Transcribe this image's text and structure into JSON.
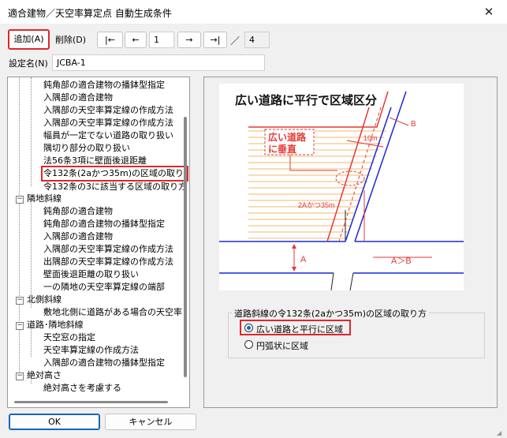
{
  "window": {
    "title": "適合建物／天空率算定点 自動生成条件",
    "close_glyph": "✕"
  },
  "toolbar": {
    "add_label": "追加(A)",
    "delete_label": "削除(D)",
    "first_label": "|←",
    "prev_label": "←",
    "current_page": "1",
    "next_label": "→",
    "last_label": "→|",
    "separator": "／",
    "total_pages": "4"
  },
  "setting": {
    "label": "設定名(N)",
    "value": "JCBA-1"
  },
  "tree": {
    "items": [
      {
        "label": "鈍角部の適合建物の播鉢型指定"
      },
      {
        "label": "入隅部の適合建物"
      },
      {
        "label": "入隅部の天空率算定線の作成方法"
      },
      {
        "label": "入隅部の天空率算定線の作成方法"
      },
      {
        "label": "幅員が一定でない道路の取り扱い"
      },
      {
        "label": "隅切り部分の取り扱い"
      },
      {
        "label": "法56条3項に壁面後退距離"
      },
      {
        "label": "令132条(2aかつ35m)の区域の取り方"
      },
      {
        "label": "令132条の3に該当する区域の取り方"
      },
      {
        "label": "隣地斜線"
      },
      {
        "label": "鈍角部の適合建物"
      },
      {
        "label": "鈍角部の適合建物の播鉢型指定"
      },
      {
        "label": "入隅部の適合建物"
      },
      {
        "label": "入隅部の天空率算定線の作成方法"
      },
      {
        "label": "出隅部の天空率算定線の作成方法"
      },
      {
        "label": "壁面後退距離の取り扱い"
      },
      {
        "label": "一の隣地の天空率算定線の端部"
      },
      {
        "label": "北側斜線"
      },
      {
        "label": "敷地北側に道路がある場合の天空率"
      },
      {
        "label": "道路･隣地斜線"
      },
      {
        "label": "天空窓の指定"
      },
      {
        "label": "天空率算定線の作成方法"
      },
      {
        "label": "入隅部の適合建物の播鉢型指定"
      },
      {
        "label": "絶対高さ"
      },
      {
        "label": "絶対高さを考慮する"
      }
    ]
  },
  "diagram": {
    "title": "広い道路に平行で区域区分",
    "annot_perp_line1": "広い道路",
    "annot_perp_line2": "に垂直",
    "label_10m": "10m",
    "label_2a35": "2Aかつ35m",
    "label_A": "A",
    "label_B": "B",
    "label_AgtB": "A＞B"
  },
  "options": {
    "group_label": "道路斜線の令132条(2aかつ35m)の区域の取り方",
    "items": [
      {
        "label": "広い道路と平行に区域",
        "selected": true
      },
      {
        "label": "円弧状に区域",
        "selected": false
      }
    ]
  },
  "buttons": {
    "ok_label": "OK",
    "cancel_label": "キャンセル"
  },
  "colors": {
    "highlight": "#e0262b",
    "accent": "#1565c0",
    "diagram_red": "#e53935",
    "diagram_blue": "#1a28d6",
    "hatch": "#f3b96b"
  }
}
